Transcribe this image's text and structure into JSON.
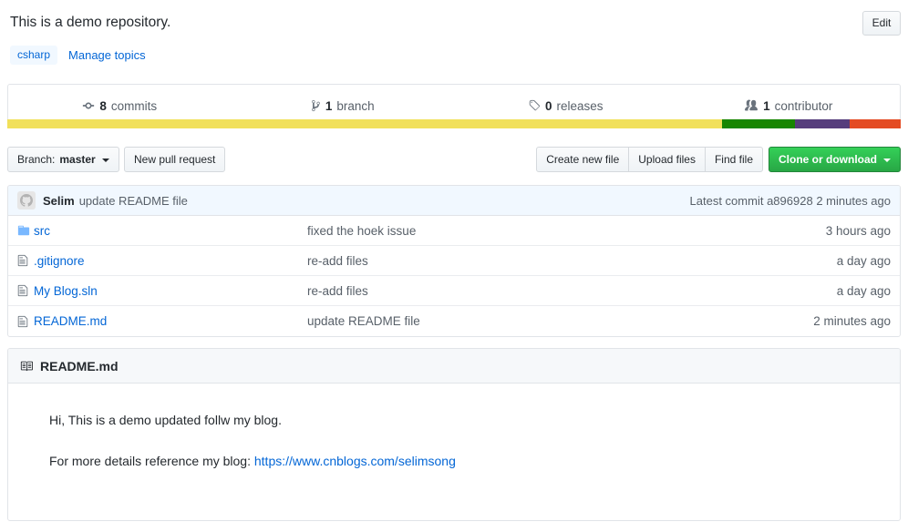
{
  "repo": {
    "description": "This is a demo repository.",
    "edit_label": "Edit"
  },
  "topics": {
    "tags": [
      "csharp"
    ],
    "manage_label": "Manage topics"
  },
  "stats": [
    {
      "icon": "commit-icon",
      "count": "8",
      "label": "commits"
    },
    {
      "icon": "branch-icon",
      "count": "1",
      "label": "branch"
    },
    {
      "icon": "tag-icon",
      "count": "0",
      "label": "releases"
    },
    {
      "icon": "contributors-icon",
      "count": "1",
      "label": "contributor"
    }
  ],
  "language_bar": [
    {
      "name": "yellow-segment",
      "color": "#f1e05a",
      "percent": 80.0
    },
    {
      "name": "green-segment",
      "color": "#178600",
      "percent": 8.2
    },
    {
      "name": "purple-segment",
      "color": "#563d7c",
      "percent": 6.1
    },
    {
      "name": "orange-segment",
      "color": "#e44b23",
      "percent": 5.7
    }
  ],
  "toolbar": {
    "branch_label": "Branch:",
    "branch_name": "master",
    "new_pull_request": "New pull request",
    "create_new_file": "Create new file",
    "upload_files": "Upload files",
    "find_file": "Find file",
    "clone_or_download": "Clone or download"
  },
  "latest_commit": {
    "author": "Selim",
    "message": "update README file",
    "prefix": "Latest commit",
    "sha": "a896928",
    "age": "2 minutes ago"
  },
  "files": [
    {
      "type": "folder",
      "name": "src",
      "message": "fixed the hoek issue",
      "age": "3 hours ago"
    },
    {
      "type": "file",
      "name": ".gitignore",
      "message": "re-add files",
      "age": "a day ago"
    },
    {
      "type": "file",
      "name": "My Blog.sln",
      "message": "re-add files",
      "age": "a day ago"
    },
    {
      "type": "file",
      "name": "README.md",
      "message": "update README file",
      "age": "2 minutes ago"
    }
  ],
  "readme": {
    "title": "README.md",
    "line1": "Hi, This is a demo updated follw my blog.",
    "line2_prefix": "For more details reference my blog: ",
    "link_text": "https://www.cnblogs.com/selimsong"
  },
  "colors": {
    "link": "#0366d6",
    "green_button": "#28a745",
    "commit_bar_bg": "#f1f8ff",
    "border": "#e1e4e8"
  }
}
